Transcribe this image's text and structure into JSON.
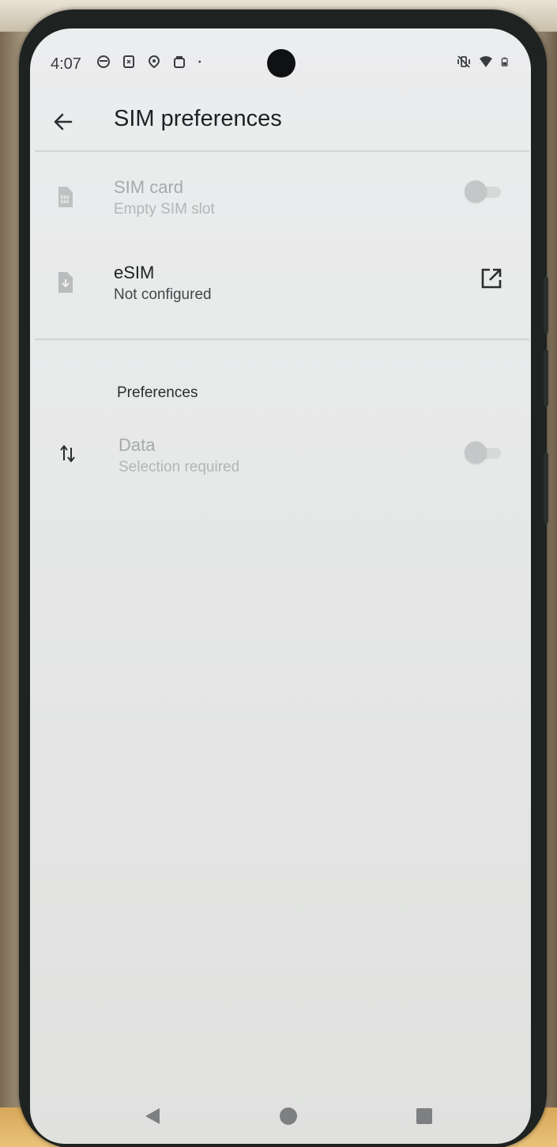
{
  "status_bar": {
    "time": "4:07",
    "left_icons": [
      "notification-icon-1",
      "notification-icon-2",
      "notification-icon-3",
      "notification-icon-4",
      "more-notifications-dot-icon"
    ],
    "right_icons": [
      "vibrate-off-icon",
      "wifi-icon",
      "battery-icon"
    ]
  },
  "app_bar": {
    "back_icon": "arrow-back-icon",
    "title": "SIM preferences"
  },
  "sims": [
    {
      "title": "SIM card",
      "subtitle": "Empty SIM slot",
      "icon": "sim-card-icon",
      "enabled": false,
      "control": "toggle",
      "toggle_on": false
    },
    {
      "title": "eSIM",
      "subtitle": "Not configured",
      "icon": "esim-download-icon",
      "enabled": true,
      "control": "open-external-icon"
    }
  ],
  "preferences": {
    "header": "Preferences",
    "data": {
      "title": "Data",
      "subtitle": "Selection required",
      "icon": "swap-vert-icon",
      "enabled": false,
      "toggle_on": false
    }
  },
  "nav_bar": {
    "buttons": [
      "back-triangle-icon",
      "home-circle-icon",
      "recents-square-icon"
    ]
  },
  "colors": {
    "screen_background": "#e8e9e9",
    "text_primary": "#1e2022",
    "text_disabled": "#a7a9ab"
  }
}
